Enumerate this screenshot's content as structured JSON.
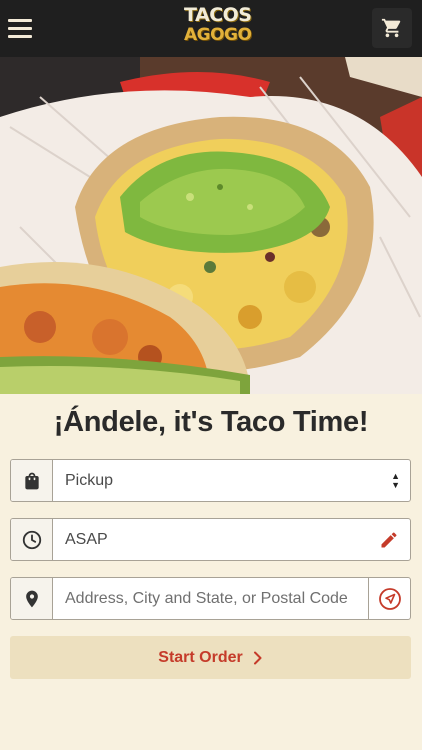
{
  "header": {
    "logo_line1": "TACOS",
    "logo_line2": "AGOGO",
    "menu_icon": "hamburger-menu-icon",
    "cart_icon": "shopping-cart-icon"
  },
  "main": {
    "headline": "¡Ándele, it's Taco Time!",
    "order_type": {
      "selected": "Pickup",
      "icon": "shopping-bag-icon"
    },
    "time": {
      "value": "ASAP",
      "icon": "clock-icon",
      "edit_icon": "pencil-icon"
    },
    "address": {
      "placeholder": "Address, City and State, or Postal Code",
      "icon": "location-pin-icon",
      "locate_icon": "navigation-arrow-icon"
    },
    "start_button": {
      "label": "Start Order",
      "icon": "chevron-right-icon"
    }
  },
  "colors": {
    "background": "#f8f1df",
    "topbar": "#1f1f1f",
    "accent_red": "#c53b2a",
    "button_bg": "#ede0bf",
    "logo_gold": "#e2b13a"
  }
}
